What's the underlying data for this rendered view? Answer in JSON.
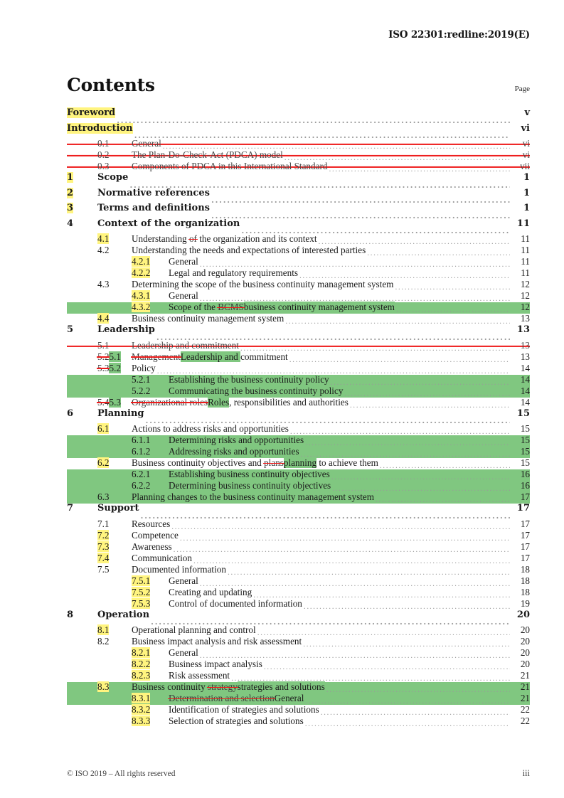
{
  "header": {
    "standard_ref": "ISO 22301:redline:2019(E)"
  },
  "title": {
    "contents": "Contents",
    "page_label": "Page"
  },
  "footer": {
    "copyright": "© ISO 2019 – All rights reserved",
    "folio": "iii"
  },
  "colors": {
    "highlight_yellow": "#fff47f",
    "highlight_green": "#80c780",
    "strike_red": "#ee1c1c",
    "leader_gray": "#9a9a9a"
  },
  "toc": [
    {
      "level": 0,
      "num": "",
      "title": "Foreword",
      "page": "v",
      "num_hl": "none",
      "title_hl": "yellow",
      "struck": false
    },
    {
      "level": 0,
      "num": "",
      "title": "Introduction",
      "page": "vi",
      "num_hl": "none",
      "title_hl": "yellow",
      "struck": false
    },
    {
      "level": 2,
      "num": "0.1",
      "title": "General",
      "page": "vi",
      "num_hl": "none",
      "title_hl": "none",
      "struck": true
    },
    {
      "level": 2,
      "num": "0.2",
      "title": "The Plan-Do-Check-Act (PDCA) model",
      "page": "vi",
      "num_hl": "none",
      "title_hl": "none",
      "struck": true
    },
    {
      "level": 2,
      "num": "0.3",
      "title": "Components of PDCA in this International Standard",
      "page": "vii",
      "num_hl": "none",
      "title_hl": "none",
      "struck": true
    },
    {
      "level": 1,
      "num": "1",
      "title": "Scope",
      "page": "1",
      "num_hl": "yellow",
      "title_hl": "none",
      "struck": false
    },
    {
      "level": 1,
      "num": "2",
      "title": "Normative references",
      "page": "1",
      "num_hl": "yellow",
      "title_hl": "none",
      "struck": false
    },
    {
      "level": 1,
      "num": "3",
      "title": "Terms and definitions",
      "page": "1",
      "num_hl": "yellow",
      "title_hl": "none",
      "struck": false
    },
    {
      "level": 1,
      "num": "4",
      "title": "Context of the organization",
      "page": "11",
      "num_hl": "none",
      "title_hl": "none",
      "struck": false
    },
    {
      "level": 2,
      "num": "4.1",
      "page": "11",
      "num_hl": "yellow",
      "struck": false,
      "parts": [
        {
          "t": "Understanding ",
          "s": "plain"
        },
        {
          "t": "of",
          "s": "del"
        },
        {
          "t": " the organization and its context",
          "s": "plain"
        }
      ]
    },
    {
      "level": 2,
      "num": "4.2",
      "title": "Understanding the needs and expectations of interested parties",
      "page": "11",
      "num_hl": "none",
      "title_hl": "none",
      "struck": false
    },
    {
      "level": 3,
      "num": "4.2.1",
      "title": "General",
      "page": "11",
      "num_hl": "yellow",
      "title_hl": "none",
      "struck": false
    },
    {
      "level": 3,
      "num": "4.2.2",
      "title": "Legal and regulatory requirements",
      "page": "11",
      "num_hl": "yellow",
      "title_hl": "none",
      "struck": false
    },
    {
      "level": 2,
      "num": "4.3",
      "title": "Determining the scope of the business continuity management system",
      "page": "12",
      "num_hl": "none",
      "title_hl": "none",
      "struck": false
    },
    {
      "level": 3,
      "num": "4.3.1",
      "title": "General",
      "page": "12",
      "num_hl": "yellow",
      "title_hl": "none",
      "struck": false
    },
    {
      "level": 3,
      "num": "4.3.2",
      "page": "12",
      "num_hl": "yellow",
      "struck": false,
      "band": "green-to-end",
      "parts": [
        {
          "t": "Scope of the ",
          "s": "plain"
        },
        {
          "t": "BCMS",
          "s": "del"
        },
        {
          "t": "business continuity management system",
          "s": "ins"
        }
      ]
    },
    {
      "level": 2,
      "num": "4.4",
      "title": "Business continuity management system",
      "page": "13",
      "num_hl": "yellow",
      "title_hl": "none",
      "struck": false
    },
    {
      "level": 1,
      "num": "5",
      "title": "Leadership",
      "page": "13",
      "num_hl": "none",
      "title_hl": "none",
      "struck": false
    },
    {
      "level": 2,
      "num": "5.1",
      "title": "Leadership and commitment",
      "page": "13",
      "num_hl": "none",
      "title_hl": "none",
      "struck": true
    },
    {
      "level": 2,
      "page": "13",
      "struck": false,
      "num_parts": [
        {
          "t": "5.2",
          "s": "del"
        },
        {
          "t": "5.1",
          "s": "ins"
        }
      ],
      "parts": [
        {
          "t": "Management",
          "s": "del"
        },
        {
          "t": "Leadership and ",
          "s": "ins"
        },
        {
          "t": "commitment",
          "s": "plain"
        }
      ]
    },
    {
      "level": 2,
      "page": "14",
      "struck": false,
      "num_parts": [
        {
          "t": "5.3",
          "s": "del"
        },
        {
          "t": "5.2",
          "s": "ins"
        }
      ],
      "parts": [
        {
          "t": "Policy",
          "s": "plain"
        }
      ]
    },
    {
      "level": 3,
      "num": "5.2.1",
      "title": "Establishing the business continuity policy",
      "page": "14",
      "num_hl": "none",
      "title_hl": "none",
      "struck": false,
      "band": "green-full"
    },
    {
      "level": 3,
      "num": "5.2.2",
      "title": "Communicating the business continuity policy",
      "page": "14",
      "num_hl": "none",
      "title_hl": "none",
      "struck": false,
      "band": "green-full"
    },
    {
      "level": 2,
      "page": "14",
      "struck": false,
      "num_parts": [
        {
          "t": "5.4",
          "s": "del"
        },
        {
          "t": "5.3",
          "s": "ins"
        }
      ],
      "parts": [
        {
          "t": "Organizational roles",
          "s": "del"
        },
        {
          "t": "Roles",
          "s": "ins"
        },
        {
          "t": ", responsibilities and authorities",
          "s": "plain"
        }
      ]
    },
    {
      "level": 1,
      "num": "6",
      "title": "Planning",
      "page": "15",
      "num_hl": "none",
      "title_hl": "none",
      "struck": false
    },
    {
      "level": 2,
      "num": "6.1",
      "title": "Actions to address risks and opportunities",
      "page": "15",
      "num_hl": "yellow",
      "title_hl": "none",
      "struck": false
    },
    {
      "level": 3,
      "num": "6.1.1",
      "title": "Determining risks and opportunities",
      "page": "15",
      "num_hl": "none",
      "title_hl": "none",
      "struck": false,
      "band": "green-full"
    },
    {
      "level": 3,
      "num": "6.1.2",
      "title": "Addressing risks and opportunities",
      "page": "15",
      "num_hl": "none",
      "title_hl": "none",
      "struck": false,
      "band": "green-full"
    },
    {
      "level": 2,
      "num": "6.2",
      "page": "15",
      "num_hl": "yellow",
      "struck": false,
      "parts": [
        {
          "t": "Business continuity objectives and ",
          "s": "plain"
        },
        {
          "t": "plans",
          "s": "del"
        },
        {
          "t": "planning",
          "s": "ins"
        },
        {
          "t": " to achieve them",
          "s": "plain"
        }
      ]
    },
    {
      "level": 3,
      "num": "6.2.1",
      "title": "Establishing business continuity objectives",
      "page": "16",
      "num_hl": "none",
      "title_hl": "none",
      "struck": false,
      "band": "green-full"
    },
    {
      "level": 3,
      "num": "6.2.2",
      "title": "Determining business continuity objectives",
      "page": "16",
      "num_hl": "none",
      "title_hl": "none",
      "struck": false,
      "band": "green-full"
    },
    {
      "level": 2,
      "num": "6.3",
      "title": "Planning changes to the business continuity management system",
      "page": "17",
      "num_hl": "none",
      "title_hl": "none",
      "struck": false,
      "band": "green-full"
    },
    {
      "level": 1,
      "num": "7",
      "title": "Support",
      "page": "17",
      "num_hl": "none",
      "title_hl": "none",
      "struck": false
    },
    {
      "level": 2,
      "num": "7.1",
      "title": "Resources",
      "page": "17",
      "num_hl": "none",
      "title_hl": "none",
      "struck": false
    },
    {
      "level": 2,
      "num": "7.2",
      "title": "Competence",
      "page": "17",
      "num_hl": "yellow",
      "title_hl": "none",
      "struck": false
    },
    {
      "level": 2,
      "num": "7.3",
      "title": "Awareness",
      "page": "17",
      "num_hl": "yellow",
      "title_hl": "none",
      "struck": false
    },
    {
      "level": 2,
      "num": "7.4",
      "title": "Communication",
      "page": "17",
      "num_hl": "yellow",
      "title_hl": "none",
      "struck": false
    },
    {
      "level": 2,
      "num": "7.5",
      "title": "Documented information",
      "page": "18",
      "num_hl": "none",
      "title_hl": "none",
      "struck": false
    },
    {
      "level": 3,
      "num": "7.5.1",
      "title": "General",
      "page": "18",
      "num_hl": "yellow",
      "title_hl": "none",
      "struck": false
    },
    {
      "level": 3,
      "num": "7.5.2",
      "title": "Creating and updating",
      "page": "18",
      "num_hl": "yellow",
      "title_hl": "none",
      "struck": false
    },
    {
      "level": 3,
      "num": "7.5.3",
      "title": "Control of documented information",
      "page": "19",
      "num_hl": "yellow",
      "title_hl": "none",
      "struck": false
    },
    {
      "level": 1,
      "num": "8",
      "title": "Operation",
      "page": "20",
      "num_hl": "none",
      "title_hl": "none",
      "struck": false
    },
    {
      "level": 2,
      "num": "8.1",
      "title": "Operational planning and control",
      "page": "20",
      "num_hl": "yellow",
      "title_hl": "none",
      "struck": false
    },
    {
      "level": 2,
      "num": "8.2",
      "title": "Business impact analysis and risk assessment",
      "page": "20",
      "num_hl": "none",
      "title_hl": "none",
      "struck": false
    },
    {
      "level": 3,
      "num": "8.2.1",
      "title": "General",
      "page": "20",
      "num_hl": "yellow",
      "title_hl": "none",
      "struck": false
    },
    {
      "level": 3,
      "num": "8.2.2",
      "title": "Business impact analysis",
      "page": "20",
      "num_hl": "yellow",
      "title_hl": "none",
      "struck": false
    },
    {
      "level": 3,
      "num": "8.2.3",
      "title": "Risk assessment",
      "page": "21",
      "num_hl": "yellow",
      "title_hl": "none",
      "struck": false
    },
    {
      "level": 2,
      "num": "8.3",
      "page": "21",
      "num_hl": "yellow",
      "struck": false,
      "band": "green-to-end",
      "parts": [
        {
          "t": "Business continuity ",
          "s": "plain"
        },
        {
          "t": "strategy",
          "s": "del"
        },
        {
          "t": "strategies and solutions",
          "s": "ins"
        }
      ]
    },
    {
      "level": 3,
      "num": "8.3.1",
      "page": "21",
      "num_hl": "yellow",
      "struck": false,
      "band": "green-to-end",
      "parts": [
        {
          "t": "Determination and selection",
          "s": "del"
        },
        {
          "t": "General",
          "s": "ins"
        }
      ]
    },
    {
      "level": 3,
      "num": "8.3.2",
      "title": "Identification of strategies and solutions",
      "page": "22",
      "num_hl": "yellow",
      "title_hl": "none",
      "struck": false
    },
    {
      "level": 3,
      "num": "8.3.3",
      "title": "Selection of strategies and solutions",
      "page": "22",
      "num_hl": "yellow",
      "title_hl": "none",
      "struck": false
    }
  ]
}
